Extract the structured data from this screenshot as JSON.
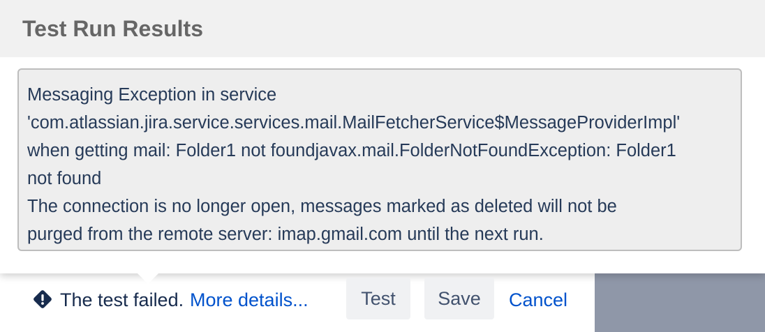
{
  "dialog": {
    "title": "Test Run Results",
    "message_lines": [
      "Messaging Exception in service",
      "'com.atlassian.jira.service.services.mail.MailFetcherService$MessageProviderImpl'",
      "when getting mail: Folder1 not foundjavax.mail.FolderNotFoundException: Folder1",
      "not found",
      "The connection is no longer open, messages marked as deleted will not be",
      "purged from the remote server: imap.gmail.com until the next run."
    ]
  },
  "footer": {
    "status_icon": "warning-diamond-icon",
    "status_text": "The test failed.",
    "details_link": "More details...",
    "test_button": "Test",
    "save_button": "Save",
    "cancel_link": "Cancel"
  },
  "colors": {
    "text": "#172b4d",
    "link": "#0052cc",
    "button_bg": "#f0f1f3",
    "message_bg": "#eeeeee",
    "header_bg": "#f1f1f1"
  }
}
